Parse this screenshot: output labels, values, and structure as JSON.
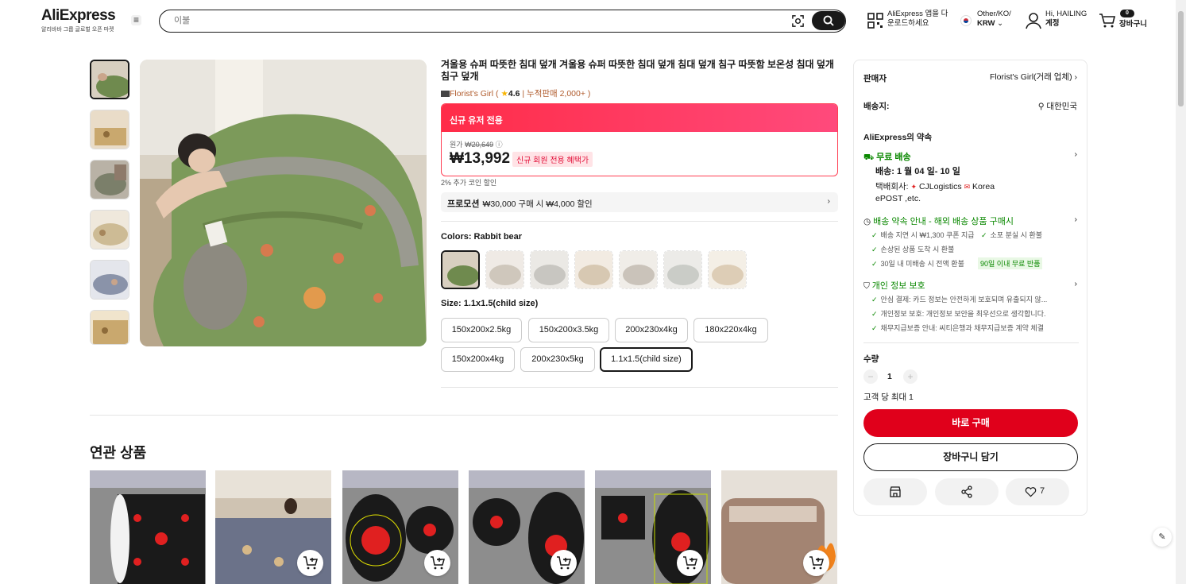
{
  "header": {
    "logo_main": "AliExpress",
    "logo_sub": "알리바바 그룹 글로벌 오픈 마켓",
    "search_placeholder": "이불",
    "app_line1": "AliExpress 앱을 다",
    "app_line2": "운로드하세요",
    "locale_line1": "Other/KO/",
    "locale_line2": "KRW",
    "user_line1": "Hi, HAILING",
    "user_line2": "계정",
    "cart_count": "0",
    "cart_label": "장바구니"
  },
  "product": {
    "title": "겨울용 슈퍼 따뜻한 침대 덮개 겨울용 슈퍼 따뜻한 침대 덮개 침대 덮개 침구 따뜻함 보온성 침대 덮개 침구 덮개",
    "store": "Florist's Girl",
    "rating": "4.6",
    "sold": "누적판매 2,000+ )",
    "promo_band": "신규 유저 전용",
    "orig_label": "원가",
    "orig_price": "₩20,649",
    "price": "₩13,992",
    "price_badge": "신규 회원 전용 혜택가",
    "coin_note": "2% 추가 코인 할인",
    "promotion_tag": "프로모션",
    "promotion_text": "₩30,000 구매 시 ₩4,000 할인",
    "colors_label": "Colors: Rabbit bear",
    "size_label": "Size: 1.1x1.5(child size)",
    "sizes": [
      "150x200x2.5kg",
      "150x200x3.5kg",
      "200x230x4kg",
      "180x220x4kg",
      "150x200x4kg",
      "200x230x5kg",
      "1.1x1.5(child size)"
    ]
  },
  "related": {
    "title": "연관 상품"
  },
  "panel": {
    "seller_label": "판매자",
    "seller_value": "Florist's Girl(거래 업체)",
    "ship_to_label": "배송지:",
    "ship_to_value": "대한민국",
    "promise_title": "AliExpress의 약속",
    "free_ship": "무료 배송",
    "delivery": "배송: 1 월 04 일- 10 일",
    "carrier_label": "택배회사:",
    "carrier1": "CJLogistics",
    "carrier2": "Korea",
    "carrier3": "ePOST ,etc.",
    "guarantee_title": "배송 약속 안내 - 해외 배송 상품 구매시",
    "g1": "배송 지연 시 ₩1,300 쿠폰 지급",
    "g2": "소포 분실 시 환불",
    "g3": "손상된 상품 도착 시 환불",
    "g4": "30일 내 미배송 시 전액 환불",
    "g4_tag": "90일 이내 무료 반품",
    "privacy_title": "개인 정보 보호",
    "p1": "안심 결제: 카드 정보는 안전하게 보호되며 유출되지 않...",
    "p2": "개인정보 보호: 개인정보 보안을 최우선으로 생각합니다.",
    "p3": "채무지급보증 안내: 씨티은행과 채무지급보증 계약 체결",
    "qty_label": "수량",
    "qty": "1",
    "limit": "고객 당 최대 1",
    "buy_now": "바로 구매",
    "add_cart": "장바구니 담기",
    "wish_count": "7"
  }
}
